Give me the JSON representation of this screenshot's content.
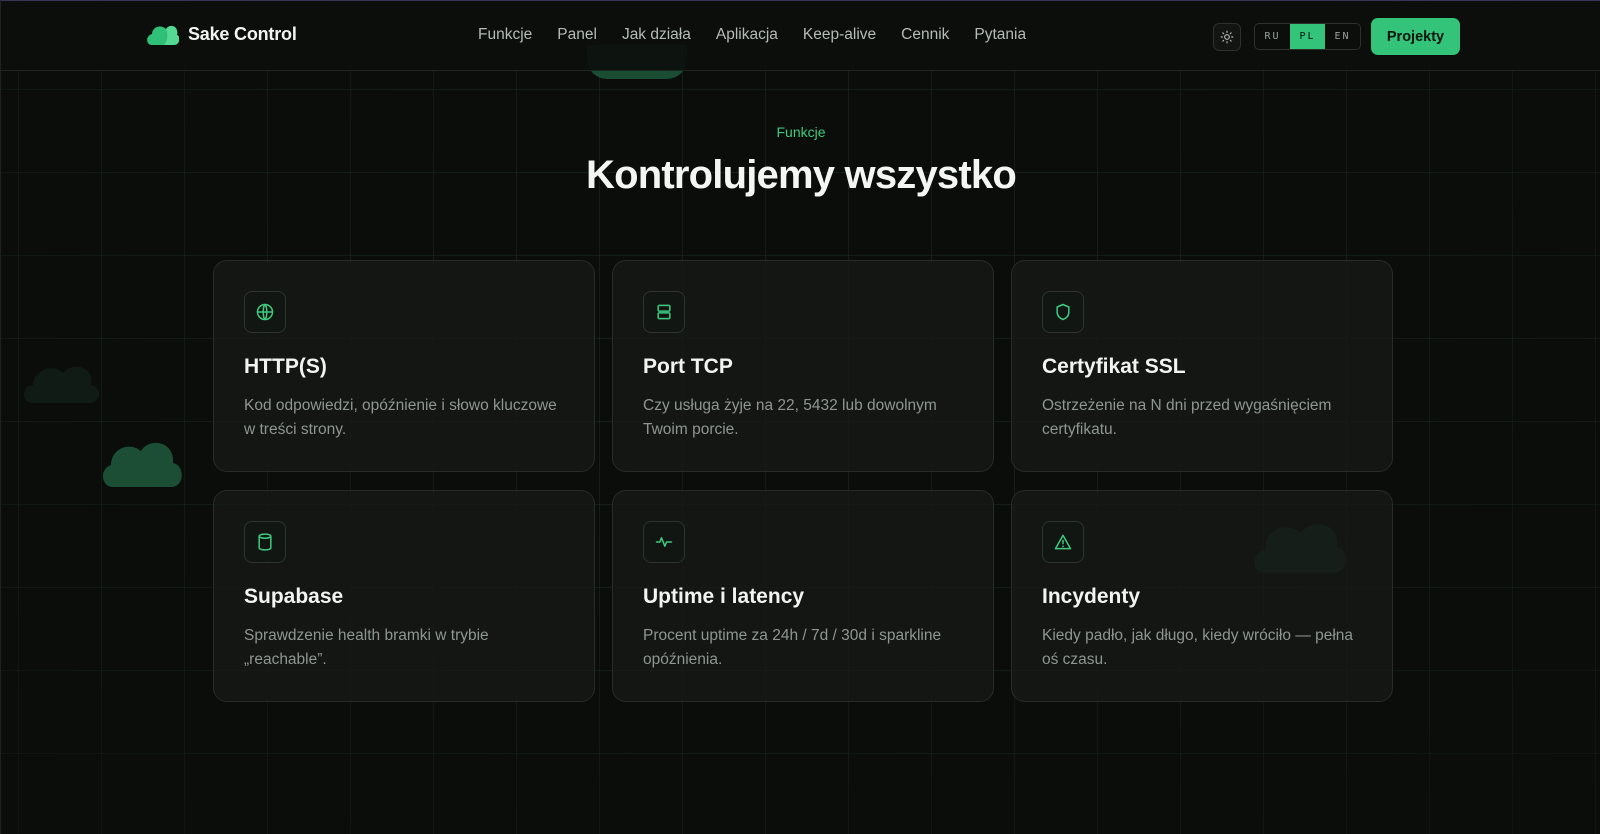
{
  "header": {
    "brand": "Sake Control",
    "nav": [
      "Funkcje",
      "Panel",
      "Jak działa",
      "Aplikacja",
      "Keep-alive",
      "Cennik",
      "Pytania"
    ],
    "theme_icon": "sun-icon",
    "languages": [
      {
        "code": "RU",
        "active": false
      },
      {
        "code": "PL",
        "active": true
      },
      {
        "code": "EN",
        "active": false
      }
    ],
    "cta": "Projekty"
  },
  "section": {
    "kicker": "Funkcje",
    "title": "Kontrolujemy wszystko"
  },
  "features": [
    {
      "icon": "globe-icon",
      "title": "HTTP(S)",
      "desc": "Kod odpowiedzi, opóźnienie i słowo kluczowe w treści strony."
    },
    {
      "icon": "server-icon",
      "title": "Port TCP",
      "desc": "Czy usługa żyje na 22, 5432 lub dowolnym Twoim porcie."
    },
    {
      "icon": "shield-icon",
      "title": "Certyfikat SSL",
      "desc": "Ostrzeżenie na N dni przed wygaśnięciem certyfikatu."
    },
    {
      "icon": "database-icon",
      "title": "Supabase",
      "desc": "Sprawdzenie health bramki w trybie „reachable”."
    },
    {
      "icon": "activity-icon",
      "title": "Uptime i latency",
      "desc": "Procent uptime za 24h / 7d / 30d i sparkline opóźnienia."
    },
    {
      "icon": "alert-triangle-icon",
      "title": "Incydenty",
      "desc": "Kiedy padło, jak długo, kiedy wróciło — pełna oś czasu."
    }
  ],
  "colors": {
    "accent": "#33c47a",
    "background": "#0b0d0b",
    "card": "#161a16"
  }
}
